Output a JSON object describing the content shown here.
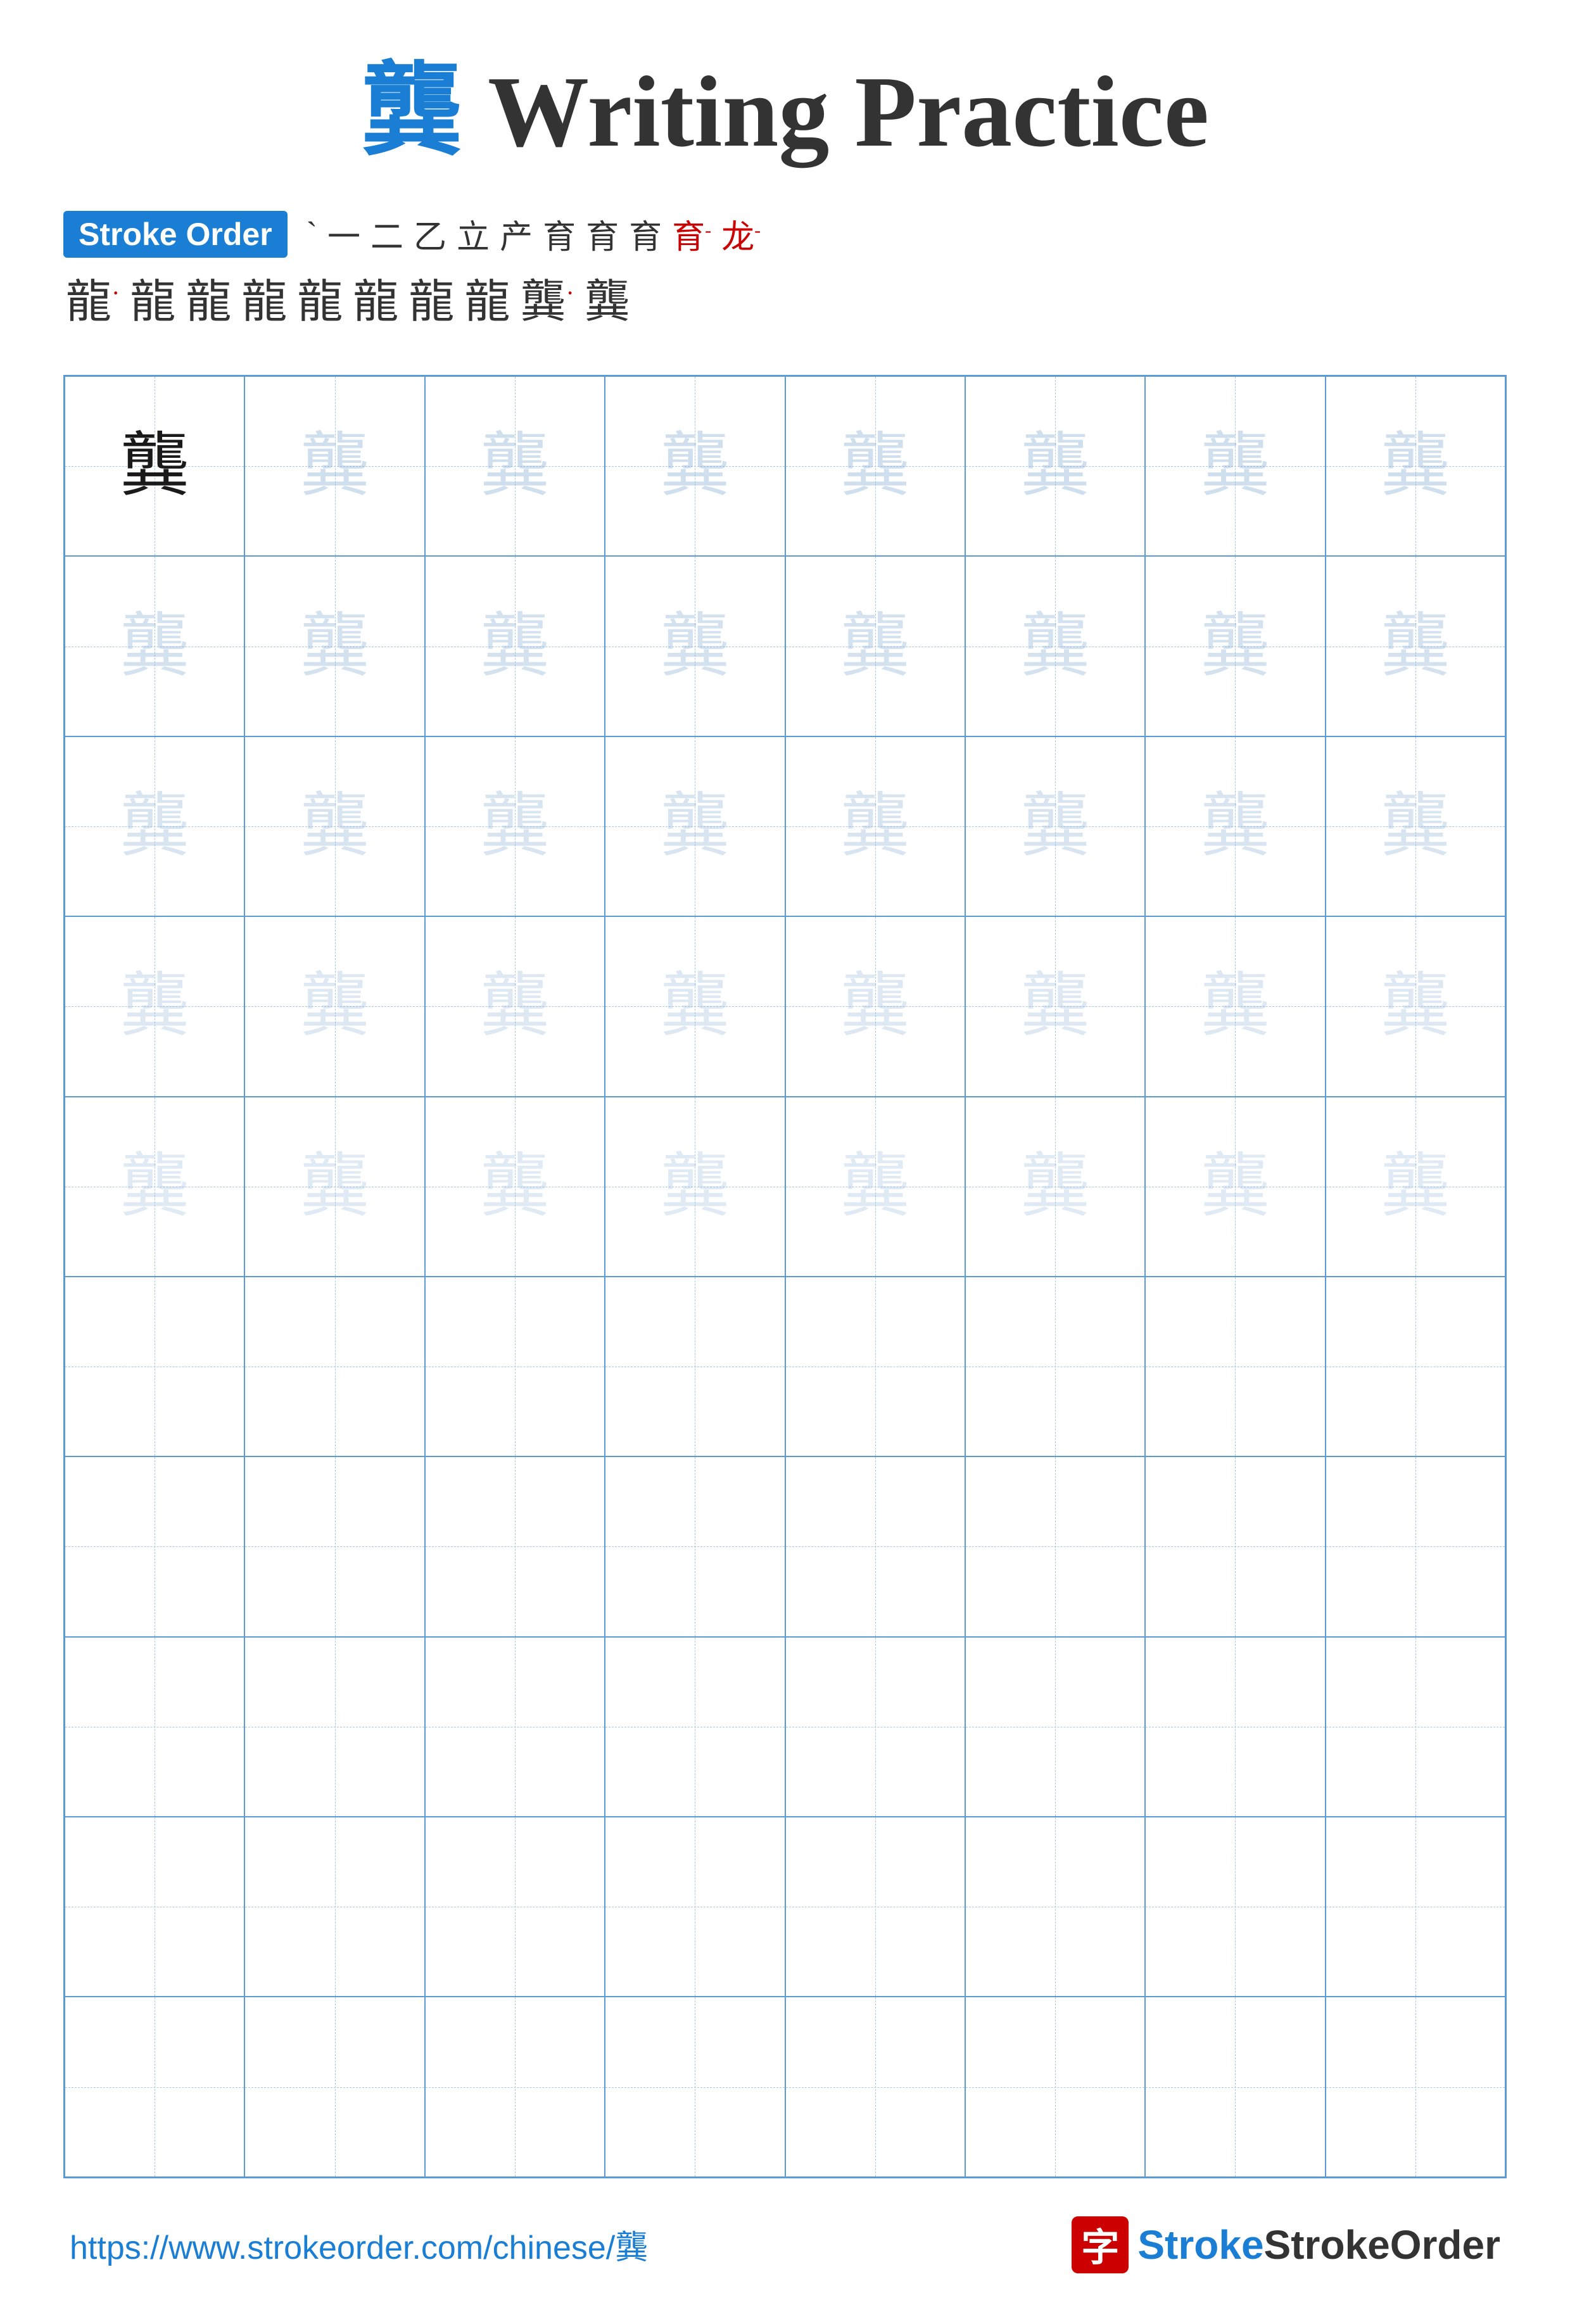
{
  "title": {
    "char": "龔",
    "suffix": " Writing Practice"
  },
  "stroke_order": {
    "badge_label": "Stroke Order",
    "steps_row1": [
      "`",
      "一",
      "二",
      "乙",
      "立",
      "产",
      "育",
      "育",
      "育",
      "育°",
      "龙°"
    ],
    "steps_row2": [
      "龍",
      "龍",
      "龍",
      "龍",
      "龍",
      "龍",
      "龍",
      "龍",
      "龔",
      "龔"
    ]
  },
  "grid": {
    "cols": 8,
    "rows": 10,
    "char": "龔",
    "dark_cells": [
      0
    ],
    "light_cells": [
      1,
      2,
      3,
      4,
      5,
      6,
      7,
      8,
      9,
      10,
      11,
      12,
      13,
      14,
      15,
      16,
      17,
      18,
      19,
      20,
      21,
      22,
      23,
      24,
      25,
      26,
      27,
      28,
      29,
      30,
      31,
      32,
      33,
      34,
      35,
      36,
      37,
      38,
      39
    ],
    "empty_cells": [
      40,
      41,
      42,
      43,
      44,
      45,
      46,
      47,
      48,
      49,
      50,
      51,
      52,
      53,
      54,
      55,
      56,
      57,
      58,
      59,
      60,
      61,
      62,
      63,
      64,
      65,
      66,
      67,
      68,
      69,
      70,
      71,
      72,
      73,
      74,
      75,
      76,
      77,
      78,
      79
    ]
  },
  "footer": {
    "url": "https://www.strokeorder.com/chinese/龔",
    "brand_icon": "字",
    "brand_name": "StrokeOrder"
  }
}
